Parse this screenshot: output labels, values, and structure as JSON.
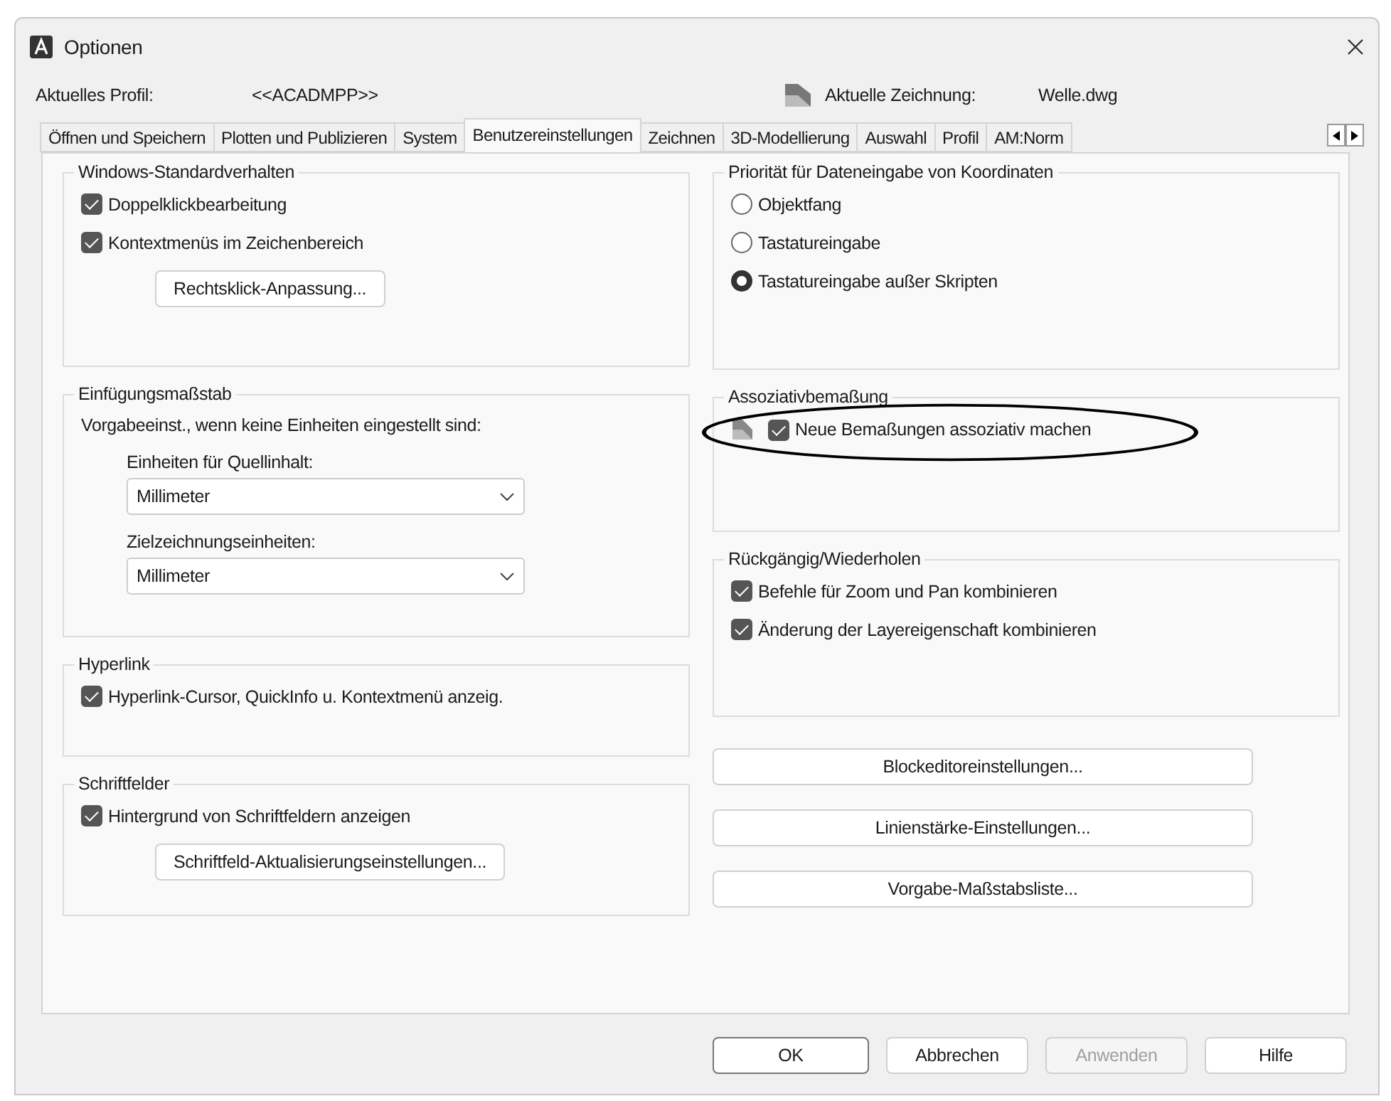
{
  "window": {
    "title": "Optionen"
  },
  "profile": {
    "label": "Aktuelles Profil:",
    "value": "<<ACADMPP>>"
  },
  "drawing": {
    "label": "Aktuelle Zeichnung:",
    "value": "Welle.dwg"
  },
  "tabs": [
    {
      "label": "Öffnen und Speichern",
      "selected": false
    },
    {
      "label": "Plotten und Publizieren",
      "selected": false
    },
    {
      "label": "System",
      "selected": false
    },
    {
      "label": "Benutzereinstellungen",
      "selected": true
    },
    {
      "label": "Zeichnen",
      "selected": false
    },
    {
      "label": "3D-Modellierung",
      "selected": false
    },
    {
      "label": "Auswahl",
      "selected": false
    },
    {
      "label": "Profil",
      "selected": false
    },
    {
      "label": "AM:Norm",
      "selected": false
    }
  ],
  "left_groups": [
    {
      "title": "Windows-Standardverhalten",
      "items": [
        {
          "kind": "checkbox",
          "label": "Doppelklickbearbeitung",
          "checked": true
        },
        {
          "kind": "checkbox",
          "label": "Kontextmenüs im Zeichenbereich",
          "checked": true
        },
        {
          "kind": "button",
          "label": "Rechtsklick-Anpassung..."
        }
      ]
    },
    {
      "title": "Einfügungsmaßstab",
      "items": [
        {
          "kind": "text",
          "label": "Vorgabeeinst., wenn keine Einheiten eingestellt sind:"
        },
        {
          "kind": "select",
          "label": "Einheiten für Quellinhalt:",
          "value": "Millimeter"
        },
        {
          "kind": "select",
          "label": "Zielzeichnungseinheiten:",
          "value": "Millimeter"
        }
      ]
    },
    {
      "title": "Hyperlink",
      "items": [
        {
          "kind": "checkbox",
          "label": "Hyperlink-Cursor, QuickInfo u. Kontextmenü anzeig.",
          "checked": true
        }
      ]
    },
    {
      "title": "Schriftfelder",
      "items": [
        {
          "kind": "checkbox",
          "label": "Hintergrund von Schriftfeldern anzeigen",
          "checked": true
        },
        {
          "kind": "button",
          "label": "Schriftfeld-Aktualisierungseinstellungen..."
        }
      ]
    }
  ],
  "right_groups": [
    {
      "title": "Priorität für Dateneingabe von Koordinaten",
      "items": [
        {
          "kind": "radio",
          "label": "Objektfang",
          "selected": false
        },
        {
          "kind": "radio",
          "label": "Tastatureingabe",
          "selected": false
        },
        {
          "kind": "radio",
          "label": "Tastatureingabe außer Skripten",
          "selected": true
        }
      ]
    },
    {
      "title": "Assoziativbemaßung",
      "items": [
        {
          "kind": "checkbox",
          "label": "Neue Bemaßungen assoziativ machen",
          "checked": true,
          "icon": true,
          "circled": true
        }
      ]
    },
    {
      "title": "Rückgängig/Wiederholen",
      "items": [
        {
          "kind": "checkbox",
          "label": "Befehle für Zoom und Pan kombinieren",
          "checked": true
        },
        {
          "kind": "checkbox",
          "label": "Änderung der Layereigenschaft kombinieren",
          "checked": true
        }
      ]
    }
  ],
  "right_buttons": [
    "Blockeditoreinstellungen...",
    "Linienstärke-Einstellungen...",
    "Vorgabe-Maßstabsliste..."
  ],
  "footer_buttons": [
    {
      "label": "OK",
      "default": true,
      "disabled": false
    },
    {
      "label": "Abbrechen",
      "default": false,
      "disabled": false
    },
    {
      "label": "Anwenden",
      "default": false,
      "disabled": true
    },
    {
      "label": "Hilfe",
      "default": false,
      "disabled": false
    }
  ]
}
